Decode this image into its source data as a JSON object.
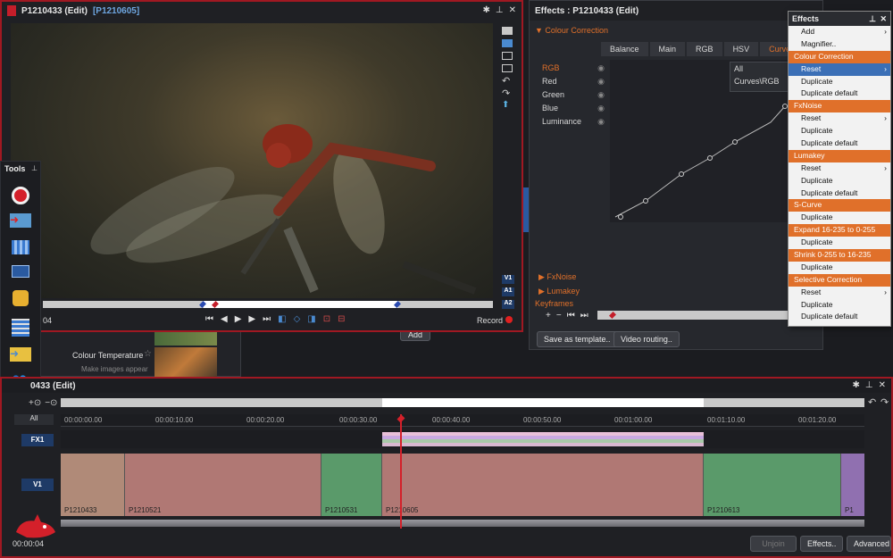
{
  "viewer": {
    "title": "P1210433 (Edit)",
    "subtitle": "[P1210605]",
    "timecode": "04",
    "record_label": "Record",
    "tracks": [
      "V1",
      "A1",
      "A2"
    ]
  },
  "tools": {
    "title": "Tools"
  },
  "effects_panel": {
    "title": "Effects : P1210433 (Edit)",
    "section": "Colour Correction",
    "tabs": [
      "Balance",
      "Main",
      "RGB",
      "HSV",
      "Curves"
    ],
    "channels": [
      "RGB",
      "Red",
      "Green",
      "Blue",
      "Luminance"
    ],
    "curve_dropdown": [
      "All",
      "Curves\\RGB"
    ],
    "collapsed": [
      "FxNoise",
      "Lumakey"
    ],
    "keyframes_label": "Keyframes",
    "save_template": "Save as template..",
    "video_routing": "Video routing.."
  },
  "browser": {
    "item_label": "Colour Temperature",
    "item_sub": "Make images appear",
    "add_label": "Add"
  },
  "context_menu": {
    "title": "Effects",
    "items": [
      {
        "label": "Add",
        "type": "item",
        "arrow": true
      },
      {
        "label": "Magnifier..",
        "type": "item"
      },
      {
        "label": "Colour Correction",
        "type": "header"
      },
      {
        "label": "Reset",
        "type": "item",
        "arrow": true,
        "selected": true
      },
      {
        "label": "Duplicate",
        "type": "item"
      },
      {
        "label": "Duplicate default",
        "type": "item"
      },
      {
        "label": "FxNoise",
        "type": "header"
      },
      {
        "label": "Reset",
        "type": "item",
        "arrow": true
      },
      {
        "label": "Duplicate",
        "type": "item"
      },
      {
        "label": "Duplicate default",
        "type": "item"
      },
      {
        "label": "Lumakey",
        "type": "header"
      },
      {
        "label": "Reset",
        "type": "item",
        "arrow": true
      },
      {
        "label": "Duplicate",
        "type": "item"
      },
      {
        "label": "Duplicate default",
        "type": "item"
      },
      {
        "label": "S-Curve",
        "type": "header"
      },
      {
        "label": "Duplicate",
        "type": "item"
      },
      {
        "label": "Expand 16-235 to 0-255",
        "type": "header"
      },
      {
        "label": "Duplicate",
        "type": "item"
      },
      {
        "label": "Shrink 0-255 to 16-235",
        "type": "header"
      },
      {
        "label": "Duplicate",
        "type": "item"
      },
      {
        "label": "Selective Correction",
        "type": "header"
      },
      {
        "label": "Reset",
        "type": "item",
        "arrow": true
      },
      {
        "label": "Duplicate",
        "type": "item"
      },
      {
        "label": "Duplicate default",
        "type": "item"
      }
    ]
  },
  "timeline": {
    "title": "0433 (Edit)",
    "all_label": "All",
    "fx_label": "FX1",
    "v1_label": "V1",
    "ruler": [
      "00:00:00.00",
      "00:00:10.00",
      "00:00:20.00",
      "00:00:30.00",
      "00:00:40.00",
      "00:00:50.00",
      "00:01:00.00",
      "00:01:10.00",
      "00:01:20.00"
    ],
    "clips": [
      "P1210433",
      "P1210521",
      "P1210531",
      "P1210605",
      "P1210613",
      "P1"
    ],
    "timecode": "00:00:04",
    "unjoin": "Unjoin",
    "effects_btn": "Effects..",
    "advanced_btn": "Advanced"
  },
  "colors": {
    "accent": "#e0702a",
    "record_red": "#a01822",
    "selected_blue": "#3b6fb6"
  }
}
